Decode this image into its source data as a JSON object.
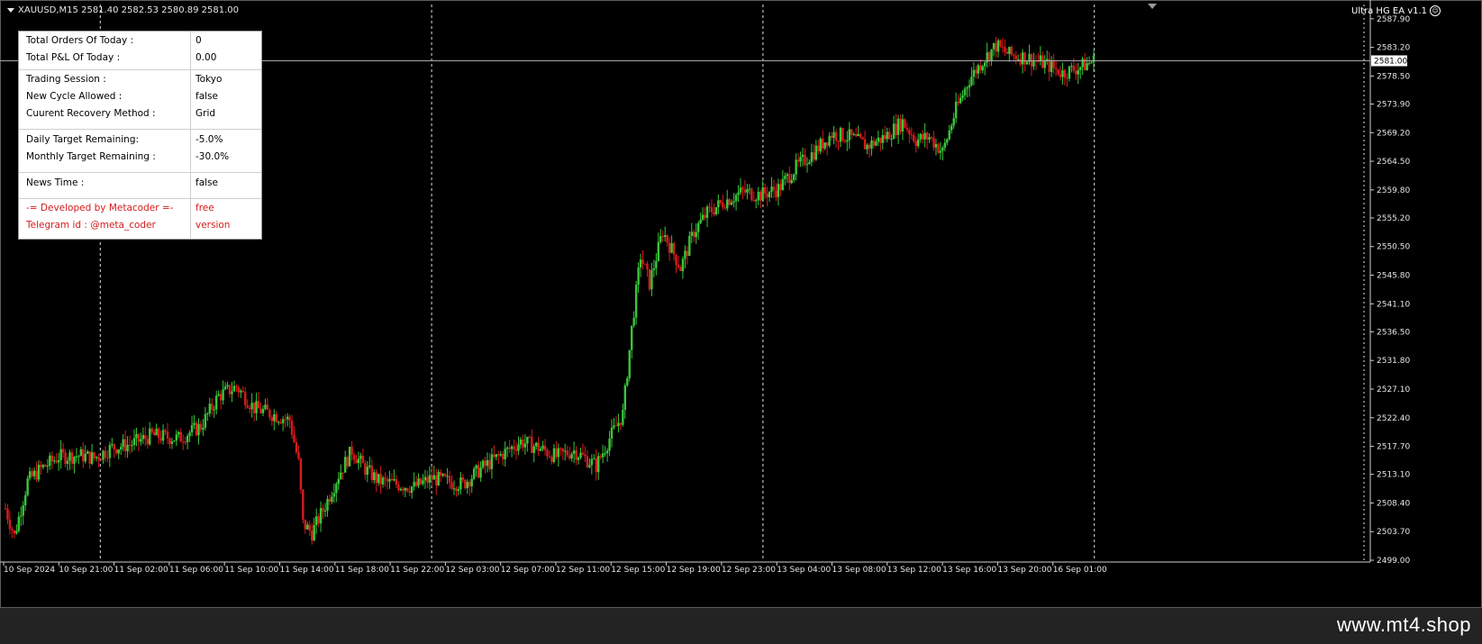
{
  "chart_header": {
    "symbol_line": "XAUUSD,M15  2581.40 2582.53 2580.89 2581.00",
    "ea_name": "Ultra HG EA  v1.1",
    "smiley_icon": "smiley-face-icon"
  },
  "info_panel": {
    "rows": [
      {
        "label": "Total Orders Of Today :",
        "value": "0"
      },
      {
        "label": "Total P&L Of Today :",
        "value": "0.00"
      },
      {
        "label": "Trading Session :",
        "value": "Tokyo"
      },
      {
        "label": "New Cycle Allowed :",
        "value": "false"
      },
      {
        "label": "Cuurent Recovery Method :",
        "value": "Grid"
      },
      {
        "label": "Daily Target Remaining:",
        "value": "-5.0%"
      },
      {
        "label": "Monthly Target Remaining :",
        "value": "-30.0%"
      },
      {
        "label": "News Time :",
        "value": "false"
      },
      {
        "label": "-= Developed by Metacoder =-",
        "value": "free"
      },
      {
        "label": "Telegram id : @meta_coder",
        "value": "version"
      }
    ],
    "highlight_color": "#d41a1a"
  },
  "price_axis": {
    "ticks": [
      "2587.90",
      "2583.20",
      "2578.50",
      "2573.90",
      "2569.20",
      "2564.50",
      "2559.80",
      "2555.20",
      "2550.50",
      "2545.80",
      "2541.10",
      "2536.50",
      "2531.80",
      "2527.10",
      "2522.40",
      "2517.70",
      "2513.10",
      "2508.40",
      "2503.70",
      "2499.00"
    ],
    "current_price": "2581.00"
  },
  "time_axis": {
    "ticks": [
      "10 Sep 2024",
      "10 Sep 21:00",
      "11 Sep 02:00",
      "11 Sep 06:00",
      "11 Sep 10:00",
      "11 Sep 14:00",
      "11 Sep 18:00",
      "11 Sep 22:00",
      "12 Sep 03:00",
      "12 Sep 07:00",
      "12 Sep 11:00",
      "12 Sep 15:00",
      "12 Sep 19:00",
      "12 Sep 23:00",
      "13 Sep 04:00",
      "13 Sep 08:00",
      "13 Sep 12:00",
      "13 Sep 16:00",
      "13 Sep 20:00",
      "16 Sep 01:00"
    ]
  },
  "chart_data": {
    "type": "candlestick",
    "symbol": "XAUUSD",
    "timeframe": "M15",
    "bull_color": "#3ac63a",
    "bear_color": "#d81c1c",
    "ylim": [
      2499.0,
      2589.5
    ],
    "current_price": 2581.0,
    "close_path": [
      [
        0,
        2507.5
      ],
      [
        4,
        2503.0
      ],
      [
        10,
        2512.0
      ],
      [
        16,
        2514.0
      ],
      [
        24,
        2516.0
      ],
      [
        34,
        2516.2
      ],
      [
        40,
        2515.8
      ],
      [
        48,
        2517.5
      ],
      [
        56,
        2518.0
      ],
      [
        66,
        2519.5
      ],
      [
        78,
        2519.0
      ],
      [
        88,
        2521.0
      ],
      [
        96,
        2526.0
      ],
      [
        104,
        2527.5
      ],
      [
        112,
        2524.0
      ],
      [
        120,
        2523.0
      ],
      [
        128,
        2522.0
      ],
      [
        132,
        2515.0
      ],
      [
        134,
        2505.0
      ],
      [
        138,
        2503.5
      ],
      [
        144,
        2508.0
      ],
      [
        150,
        2513.0
      ],
      [
        156,
        2517.0
      ],
      [
        162,
        2514.0
      ],
      [
        168,
        2512.0
      ],
      [
        176,
        2511.5
      ],
      [
        184,
        2511.0
      ],
      [
        192,
        2512.5
      ],
      [
        198,
        2512.0
      ],
      [
        206,
        2511.5
      ],
      [
        214,
        2514.0
      ],
      [
        222,
        2516.0
      ],
      [
        232,
        2518.5
      ],
      [
        240,
        2517.5
      ],
      [
        248,
        2516.0
      ],
      [
        256,
        2517.0
      ],
      [
        266,
        2514.5
      ],
      [
        272,
        2519.0
      ],
      [
        278,
        2523.0
      ],
      [
        282,
        2537.0
      ],
      [
        286,
        2549.0
      ],
      [
        290,
        2544.5
      ],
      [
        296,
        2553.0
      ],
      [
        304,
        2547.0
      ],
      [
        310,
        2553.0
      ],
      [
        316,
        2556.0
      ],
      [
        324,
        2558.0
      ],
      [
        332,
        2559.5
      ],
      [
        340,
        2559.0
      ],
      [
        348,
        2560.0
      ],
      [
        356,
        2563.5
      ],
      [
        364,
        2566.0
      ],
      [
        372,
        2569.0
      ],
      [
        380,
        2568.5
      ],
      [
        388,
        2567.0
      ],
      [
        396,
        2568.5
      ],
      [
        404,
        2571.0
      ],
      [
        410,
        2568.0
      ],
      [
        416,
        2568.5
      ],
      [
        422,
        2566.0
      ],
      [
        428,
        2573.0
      ],
      [
        434,
        2578.0
      ],
      [
        440,
        2581.0
      ],
      [
        446,
        2583.5
      ],
      [
        452,
        2582.0
      ],
      [
        460,
        2581.5
      ],
      [
        468,
        2580.5
      ],
      [
        476,
        2579.0
      ],
      [
        484,
        2580.0
      ],
      [
        490,
        2581.0
      ]
    ]
  }
}
